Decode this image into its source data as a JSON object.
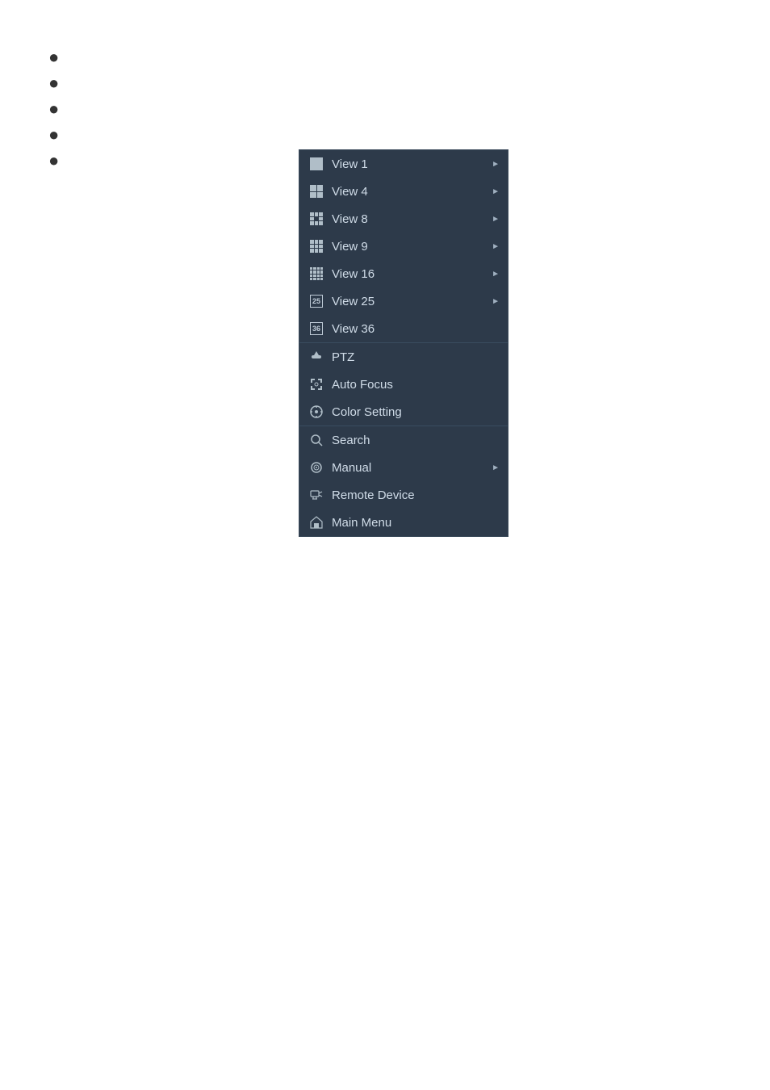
{
  "bullets": [
    "•",
    "•",
    "•",
    "•",
    "•"
  ],
  "menu": {
    "sections": [
      {
        "id": "views",
        "items": [
          {
            "id": "view1",
            "label": "View 1",
            "icon": "view1",
            "hasArrow": true
          },
          {
            "id": "view4",
            "label": "View 4",
            "icon": "view4",
            "hasArrow": true
          },
          {
            "id": "view8",
            "label": "View 8",
            "icon": "view8",
            "hasArrow": true
          },
          {
            "id": "view9",
            "label": "View 9",
            "icon": "view9",
            "hasArrow": true
          },
          {
            "id": "view16",
            "label": "View 16",
            "icon": "view16",
            "hasArrow": true
          },
          {
            "id": "view25",
            "label": "View 25",
            "icon": "view25",
            "hasArrow": true
          },
          {
            "id": "view36",
            "label": "View 36",
            "icon": "view36",
            "hasArrow": false
          }
        ]
      },
      {
        "id": "camera",
        "items": [
          {
            "id": "ptz",
            "label": "PTZ",
            "icon": "ptz",
            "hasArrow": false
          },
          {
            "id": "autofocus",
            "label": "Auto Focus",
            "icon": "autofocus",
            "hasArrow": false
          },
          {
            "id": "colorsetting",
            "label": "Color Setting",
            "icon": "color",
            "hasArrow": false
          }
        ]
      },
      {
        "id": "system",
        "items": [
          {
            "id": "search",
            "label": "Search",
            "icon": "search",
            "hasArrow": false
          },
          {
            "id": "manual",
            "label": "Manual",
            "icon": "manual",
            "hasArrow": true
          },
          {
            "id": "remotedevice",
            "label": "Remote Device",
            "icon": "remote",
            "hasArrow": false
          },
          {
            "id": "mainmenu",
            "label": "Main Menu",
            "icon": "mainmenu",
            "hasArrow": false
          }
        ]
      }
    ]
  }
}
